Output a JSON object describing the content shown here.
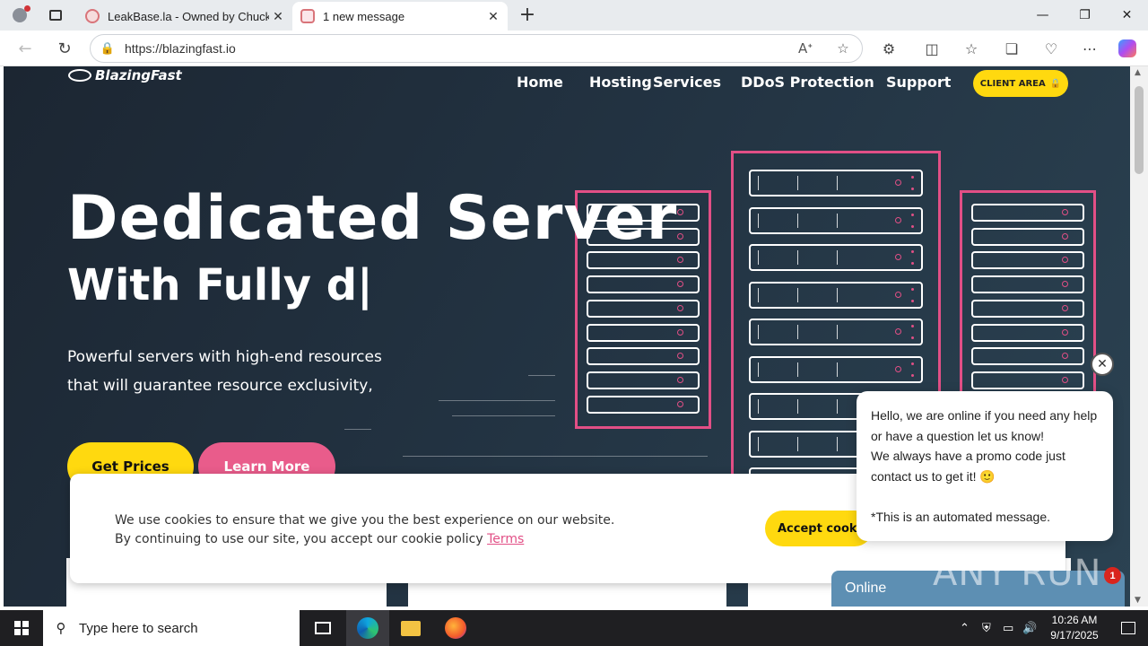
{
  "browser": {
    "tabs": [
      {
        "title": "LeakBase.la - Owned by Chucky",
        "active": false
      },
      {
        "title": "1 new message",
        "active": true
      }
    ],
    "url": "https://blazingfast.io"
  },
  "site": {
    "logo_text": "BlazingFast",
    "nav": [
      "Home",
      "Hosting",
      "Services",
      "DDoS Protection",
      "Support"
    ],
    "client_area": "CLIENT AREA",
    "hero": {
      "title": "Dedicated Server",
      "subtitle": "With Fully d|",
      "desc_line1": "Powerful servers with high-end resources",
      "desc_line2": "that will guarantee resource exclusivity,",
      "btn_prices": "Get Prices",
      "btn_learn": "Learn More"
    },
    "accent": "#e24f86",
    "yellow": "#ffd90f"
  },
  "cookie": {
    "line1": "We use cookies to ensure that we give you the best experience on our website.",
    "line2": "By continuing to use our site, you accept our cookie policy",
    "terms": "Terms",
    "accept": "Accept cookies"
  },
  "chat": {
    "line1": "Hello, we are online if you need any help",
    "line2": "or have a question let us know!",
    "line3": "We always have a promo code just",
    "line4": "contact us to get it! 🙂",
    "line5": "*This is an automated message.",
    "status": "Online",
    "badge": "1"
  },
  "watermark": "ANY RUN",
  "taskbar": {
    "search_placeholder": "Type here to search",
    "time": "10:26 AM",
    "date": "9/17/2025"
  }
}
